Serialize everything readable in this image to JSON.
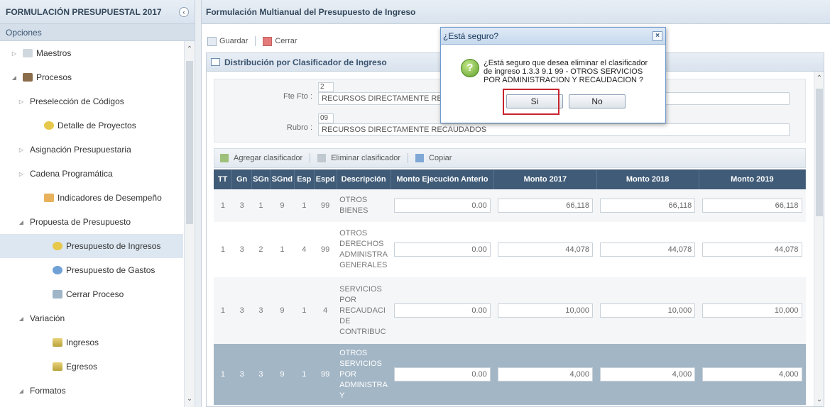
{
  "left_panel": {
    "title": "FORMULACIÓN PRESUPUESTAL 2017",
    "collapse_glyph": "‹",
    "options_label": "Opciones",
    "tree": [
      {
        "label": "Maestros",
        "indent": 0,
        "twisty": "▷",
        "icon": "folder"
      },
      {
        "label": "Procesos",
        "indent": 0,
        "twisty": "◢",
        "icon": "proc"
      },
      {
        "label": "Preselección de Códigos",
        "indent": 1,
        "twisty": "▷",
        "icon": ""
      },
      {
        "label": "Detalle de Proyectos",
        "indent": 2,
        "twisty": "",
        "icon": "yellow"
      },
      {
        "label": "Asignación Presupuestaria",
        "indent": 1,
        "twisty": "▷",
        "icon": ""
      },
      {
        "label": "Cadena Programática",
        "indent": 1,
        "twisty": "▷",
        "icon": ""
      },
      {
        "label": "Indicadores de Desempeño",
        "indent": 2,
        "twisty": "",
        "icon": "orange"
      },
      {
        "label": "Propuesta de Presupuesto",
        "indent": 1,
        "twisty": "◢",
        "icon": ""
      },
      {
        "label": "Presupuesto de Ingresos",
        "indent": 3,
        "twisty": "",
        "icon": "yellow",
        "selected": true
      },
      {
        "label": "Presupuesto de Gastos",
        "indent": 3,
        "twisty": "",
        "icon": "blue"
      },
      {
        "label": "Cerrar Proceso",
        "indent": 3,
        "twisty": "",
        "icon": "gray"
      },
      {
        "label": "Variación",
        "indent": 1,
        "twisty": "◢",
        "icon": ""
      },
      {
        "label": "Ingresos",
        "indent": 3,
        "twisty": "",
        "icon": "green"
      },
      {
        "label": "Egresos",
        "indent": 3,
        "twisty": "",
        "icon": "green"
      },
      {
        "label": "Formatos",
        "indent": 1,
        "twisty": "◢",
        "icon": ""
      }
    ]
  },
  "right_panel": {
    "title": "Formulación Multianual del Presupuesto de Ingreso",
    "toolbar": {
      "save_label": "Guardar",
      "close_label": "Cerrar"
    },
    "section_title": "Distribución por Clasificador de Ingreso",
    "form": {
      "fte_label": "Fte Fto :",
      "fte_code": "2",
      "fte_desc": "RECURSOS DIRECTAMENTE RECAUDADOS",
      "rubro_label": "Rubro :",
      "rubro_code": "09",
      "rubro_desc": "RECURSOS DIRECTAMENTE RECAUDADOS"
    },
    "subtoolbar": {
      "add_label": "Agregar clasificador",
      "delete_label": "Eliminar clasificador",
      "copy_label": "Copiar"
    },
    "table": {
      "headers": [
        "TT",
        "Gn",
        "SGn",
        "SGnd",
        "Esp",
        "Espd",
        "Descripción",
        "Monto Ejecución Anterio",
        "Monto 2017",
        "Monto 2018",
        "Monto 2019"
      ],
      "rows": [
        {
          "tt": "1",
          "gn": "3",
          "sgn": "1",
          "sgnd": "9",
          "esp": "1",
          "espd": "99",
          "desc": [
            "OTROS",
            "BIENES"
          ],
          "prev": "0.00",
          "m2017": "66,118",
          "m2018": "66,118",
          "m2019": "66,118"
        },
        {
          "tt": "1",
          "gn": "3",
          "sgn": "2",
          "sgnd": "1",
          "esp": "4",
          "espd": "99",
          "desc": [
            "OTROS",
            "DERECHOS",
            "ADMINISTRA",
            "GENERALES"
          ],
          "prev": "0.00",
          "m2017": "44,078",
          "m2018": "44,078",
          "m2019": "44,078"
        },
        {
          "tt": "1",
          "gn": "3",
          "sgn": "3",
          "sgnd": "9",
          "esp": "1",
          "espd": "4",
          "desc": [
            "SERVICIOS",
            "POR",
            "RECAUDACI",
            "DE",
            "CONTRIBUC"
          ],
          "prev": "0.00",
          "m2017": "10,000",
          "m2018": "10,000",
          "m2019": "10,000"
        },
        {
          "tt": "1",
          "gn": "3",
          "sgn": "3",
          "sgnd": "9",
          "esp": "1",
          "espd": "99",
          "desc": [
            "OTROS",
            "SERVICIOS",
            "POR",
            "ADMINISTRA",
            "Y"
          ],
          "prev": "0.00",
          "m2017": "4,000",
          "m2018": "4,000",
          "m2019": "4,000",
          "selected": true
        }
      ]
    }
  },
  "dialog": {
    "title": "¿Está seguro?",
    "close_glyph": "×",
    "icon_glyph": "?",
    "message_lines": [
      "¿Está seguro que desea eliminar el clasificador",
      "de ingreso 1.3.3 9.1 99 - OTROS SERVICIOS",
      "POR ADMINISTRACION Y RECAUDACION ?"
    ],
    "yes_label": "Si",
    "no_label": "No"
  },
  "colors": {
    "header_dark": "#3f5b77",
    "selected_row": "#a3b6c5",
    "highlight": "#c8232c"
  }
}
